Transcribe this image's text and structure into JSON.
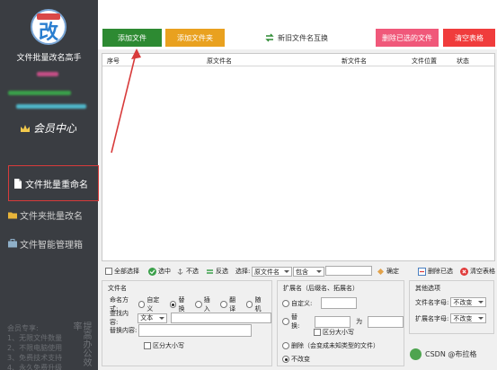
{
  "sidebar": {
    "logo_text": "改",
    "logo_badge_text": "文件批量",
    "app_title": "文件批量改名高手",
    "vip_label": "会员中心",
    "nav": [
      {
        "label": "文件批量重命名",
        "active": true
      },
      {
        "label": "文件夹批量改名",
        "active": false
      },
      {
        "label": "文件智能管理箱",
        "active": false
      }
    ],
    "promo_lines": [
      "会员专享:",
      "1、无限文件数量",
      "2、不限电脑使用",
      "3、免费技术支持",
      "4、永久免费升级"
    ],
    "promo_side": "提高办公效率"
  },
  "toolbar": {
    "add_file": "添加文件",
    "add_folder": "添加文件夹",
    "swap_names": "新旧文件名互换",
    "delete_selected": "删除已选的文件",
    "clear_table": "清空表格"
  },
  "colors": {
    "add_file": "#2d8a32",
    "add_folder": "#e9a11f",
    "delete_selected": "#f0587a",
    "clear_table": "#f03c3c",
    "annotation_arrow": "#d83b3b",
    "sidebar_bg": "#3a3d42"
  },
  "table": {
    "columns": [
      "序号",
      "原文件名",
      "新文件名",
      "文件位置",
      "状态"
    ],
    "rows": []
  },
  "selection_bar": {
    "select_all": "全部选择",
    "select": "选中",
    "deselect": "不选",
    "invert": "反选",
    "select_label": "选择:",
    "field_value": "原文件名",
    "match_value": "包含",
    "text_value": "",
    "confirm": "确定",
    "delete_selected": "删除已选",
    "clear_table": "清空表格"
  },
  "filename_panel": {
    "title": "文件名",
    "naming_mode_label": "命名方式:",
    "modes": [
      "自定义",
      "替换",
      "插入",
      "翻译",
      "随机"
    ],
    "selected_mode": "替换",
    "find_label": "查找内容:",
    "find_type": "文本",
    "find_value": "",
    "replace_label": "替换内容:",
    "replace_value": "",
    "case_sensitive": "区分大小写"
  },
  "extension_panel": {
    "title": "扩展名（后缀名、拓展名）",
    "custom": "自定义:",
    "custom_value": "",
    "replace": "替换:",
    "replace_from": "",
    "replace_to_label": "为",
    "replace_to": "",
    "case_sensitive": "区分大小写",
    "delete": "删除（会变成未知类型的文件）",
    "keep": "不改变",
    "selected": "不改变"
  },
  "other_panel": {
    "title": "其他选项",
    "filename_case_label": "文件名字母:",
    "filename_case_value": "不改变",
    "ext_case_label": "扩展名字母:",
    "ext_case_value": "不改变"
  },
  "watermark": "CSDN @布拉格"
}
